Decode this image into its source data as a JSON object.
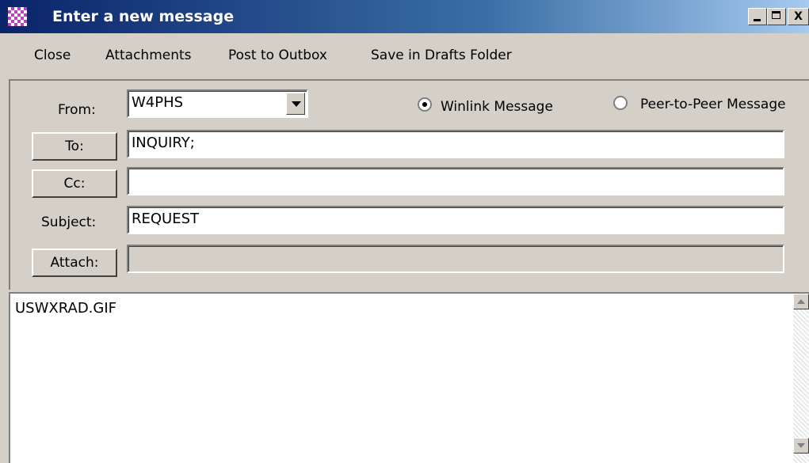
{
  "window": {
    "title": "Enter a new message",
    "controls": {
      "minimize": "_",
      "maximize": "□",
      "close": "X"
    }
  },
  "menu": {
    "items": [
      "Close",
      "Attachments",
      "Post to Outbox",
      "Save in Drafts Folder"
    ]
  },
  "form": {
    "from_label": "From:",
    "from_value": "W4PHS",
    "message_types": [
      {
        "label": "Winlink Message",
        "selected": true
      },
      {
        "label": "Peer-to-Peer Message",
        "selected": false
      }
    ],
    "to_button": "To:",
    "to_value": "INQUIRY;",
    "cc_button": "Cc:",
    "cc_value": "",
    "subject_label": "Subject:",
    "subject_value": "REQUEST",
    "attach_button": "Attach:",
    "attach_value": ""
  },
  "body": {
    "text": "USWXRAD.GIF"
  },
  "icons": [
    "app-icon",
    "dropdown-arrow-icon",
    "scroll-up-arrow-icon",
    "scroll-down-arrow-icon"
  ],
  "colors": {
    "titlebar_start": "#0a246a",
    "titlebar_end": "#a6caf0",
    "window_face": "#d4d0c8"
  }
}
